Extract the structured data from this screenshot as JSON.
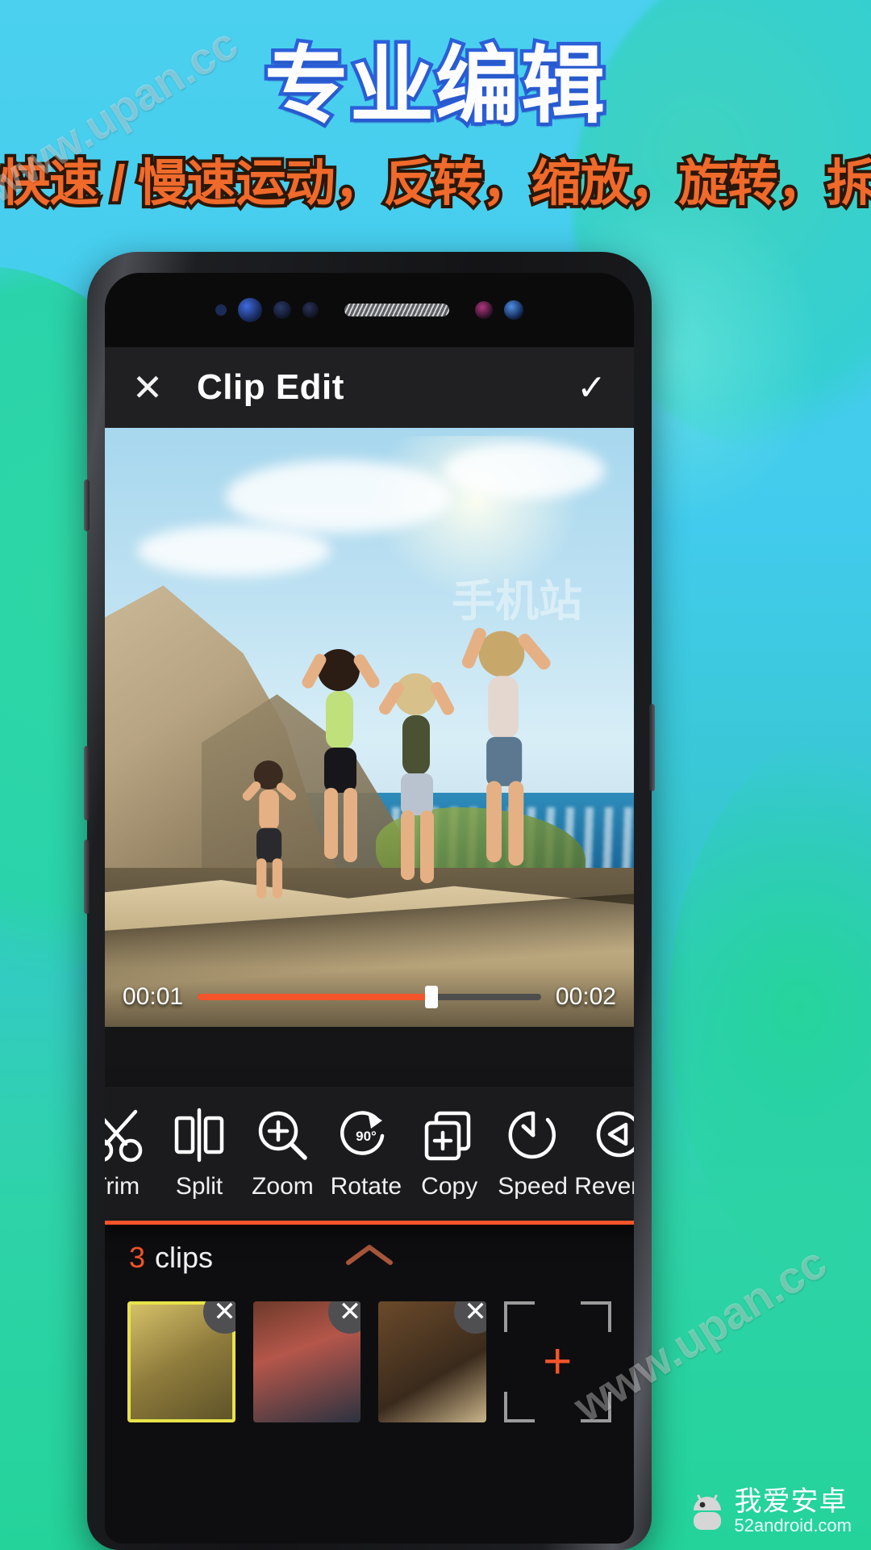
{
  "banner": {
    "title": "专业编辑",
    "subtitle": "快速 / 慢速运动，反转，缩放，旋转，拆分",
    "title_color": "#fdfdff",
    "title_outline_color": "#2b5fd9",
    "subtitle_color": "#ef6a2b"
  },
  "app": {
    "header": {
      "close_label": "✕",
      "title": "Clip Edit",
      "confirm_label": "✓"
    },
    "timeline": {
      "current_time": "00:01",
      "total_time": "00:02",
      "progress_percent": 68,
      "progress_color": "#f3542a"
    },
    "toolbar": {
      "accent_color": "#f3542a",
      "items": [
        {
          "icon": "scissors-icon",
          "label": "Trim"
        },
        {
          "icon": "split-icon",
          "label": "Split"
        },
        {
          "icon": "zoom-in-icon",
          "label": "Zoom"
        },
        {
          "icon": "rotate-90-icon",
          "label": "Rotate",
          "badge": "90°"
        },
        {
          "icon": "copy-icon",
          "label": "Copy"
        },
        {
          "icon": "speedometer-icon",
          "label": "Speed"
        },
        {
          "icon": "reverse-icon",
          "label": "Reverse"
        }
      ]
    },
    "clips_panel": {
      "count": "3",
      "count_word": "clips",
      "collapse_icon": "chevron-up-icon",
      "clips": [
        {
          "name": "clip-1",
          "delete_label": "✕",
          "selected": true
        },
        {
          "name": "clip-2",
          "delete_label": "✕",
          "selected": false
        },
        {
          "name": "clip-3",
          "delete_label": "✕",
          "selected": false
        }
      ],
      "add_label": "+"
    }
  },
  "watermarks": {
    "site_1": "www.upan.cc",
    "site_2": "www.upan.cc",
    "mobile_station": "手机站"
  },
  "badge": {
    "name": "我爱安卓",
    "domain": "52android.com"
  }
}
